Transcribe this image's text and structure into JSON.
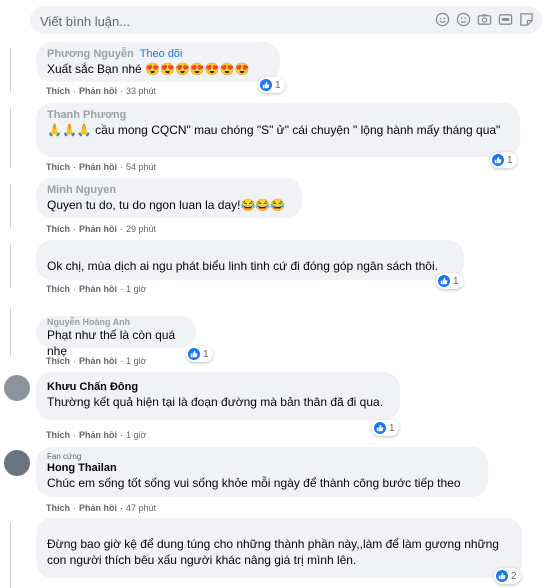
{
  "composer": {
    "placeholder": "Viết bình luận...",
    "icons": [
      "emoji-icon",
      "smiley-icon",
      "camera-icon",
      "gif-icon",
      "sticker-icon"
    ]
  },
  "labels": {
    "like": "Thích",
    "reply": "Phản hồi",
    "dot": "·"
  },
  "comments": [
    {
      "author": "Phương Nguyễn",
      "follow": "Theo dõi",
      "text": "Xuất sắc Bạn nhé 😍😍😍😍😍😍😍",
      "time": "33 phút",
      "reactions": "1"
    },
    {
      "author": "Thanh Phương",
      "text": "🙏🙏🙏 cầu mong CQCN\" mau chóng \"S\" ử\" cái chuyện \" lộng hành mấy tháng qua\"",
      "time": "54 phút",
      "reactions": "1"
    },
    {
      "author": "Minh Nguyen",
      "text": "Quyen tu do, tu do ngon luan la day!😂😂😂",
      "time": "29 phút",
      "reactions": ""
    },
    {
      "author": "",
      "text": "Ok chị, mùa dịch ai ngu phát biểu linh tinh cứ đi đóng góp ngân sách thôi.",
      "time": "1 giờ",
      "reactions": "1"
    },
    {
      "author": "Nguyễn Hoàng Anh",
      "text": "Phạt như thế là còn quá nhẹ",
      "time": "1 giờ",
      "reactions": "1"
    },
    {
      "author": "Khưu Chấn Đông",
      "text": "Thường kết quả hiện tại là đoạn đường mà bản thân đã đi qua.",
      "time": "1 giờ",
      "reactions": "1"
    },
    {
      "author": "Hong Thailan",
      "badge": "Fan cứng",
      "text": "Chúc em sống tốt sống vui sống khỏe mỗi ngày để thành công bước tiếp theo",
      "time": "47 phút",
      "reactions": ""
    },
    {
      "author": "",
      "text": "Đừng bao giờ kệ để dung túng cho những thành phần này,,làm để làm gương những con người thích bêu xấu người khác nâng giá trị mình lên.",
      "time": "",
      "reactions": "2"
    }
  ]
}
